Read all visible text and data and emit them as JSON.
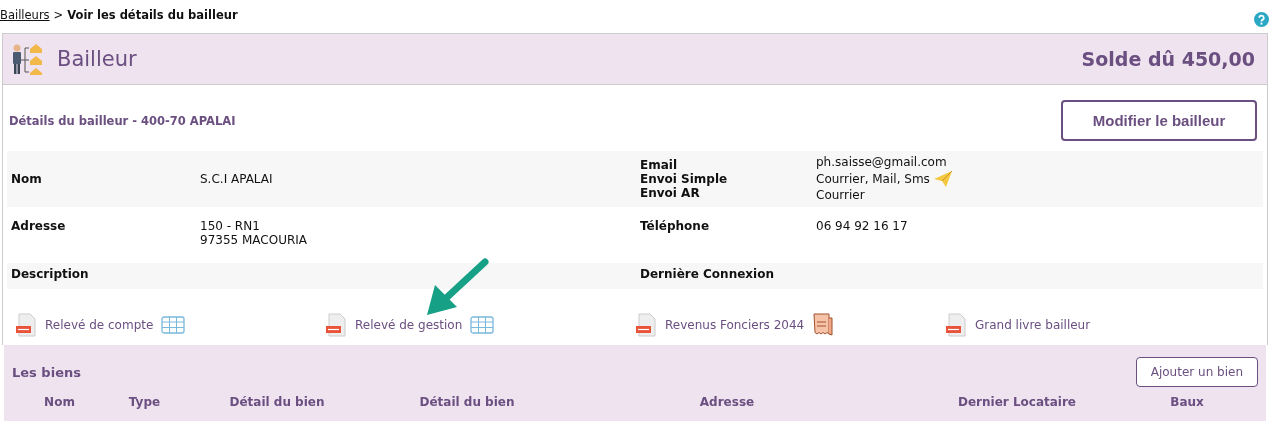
{
  "breadcrumb": {
    "link": "Bailleurs",
    "separator": ">",
    "current": "Voir les détails du bailleur"
  },
  "header": {
    "title": "Bailleur",
    "balance": "Solde dû 450,00"
  },
  "details": {
    "title": "Détails du bailleur - 400-70 APALAI",
    "edit_button": "Modifier le bailleur"
  },
  "info_rows": [
    {
      "left_labels": [
        "Nom"
      ],
      "left_values": [
        "S.C.I APALAI"
      ],
      "right_labels": [
        "Email",
        "Envoi Simple",
        "Envoi AR"
      ],
      "right_values": [
        "ph.saisse@gmail.com",
        "Courrier, Mail, Sms",
        "Courrier"
      ]
    },
    {
      "left_labels": [
        "Adresse"
      ],
      "left_values": [
        "150 - RN1",
        "97355 MACOURIA"
      ],
      "right_labels": [
        "Téléphone"
      ],
      "right_values": [
        "06 94 92 16 17"
      ]
    },
    {
      "left_labels": [
        "Description"
      ],
      "left_values": [],
      "right_labels": [
        "Dernière Connexion"
      ],
      "right_values": []
    }
  ],
  "documents": [
    {
      "label": "Relevé de compte",
      "kind": "table"
    },
    {
      "label": "Relevé de gestion",
      "kind": "table"
    },
    {
      "label": "Revenus Fonciers 2044",
      "kind": "tax"
    },
    {
      "label": "Grand livre bailleur",
      "kind": "plain"
    }
  ],
  "biens": {
    "title": "Les biens",
    "add_button": "Ajouter un bien",
    "columns": [
      "Nom",
      "Type",
      "Détail du bien",
      "Détail du bien",
      "Adresse",
      "Dernier Locataire",
      "Baux"
    ]
  }
}
